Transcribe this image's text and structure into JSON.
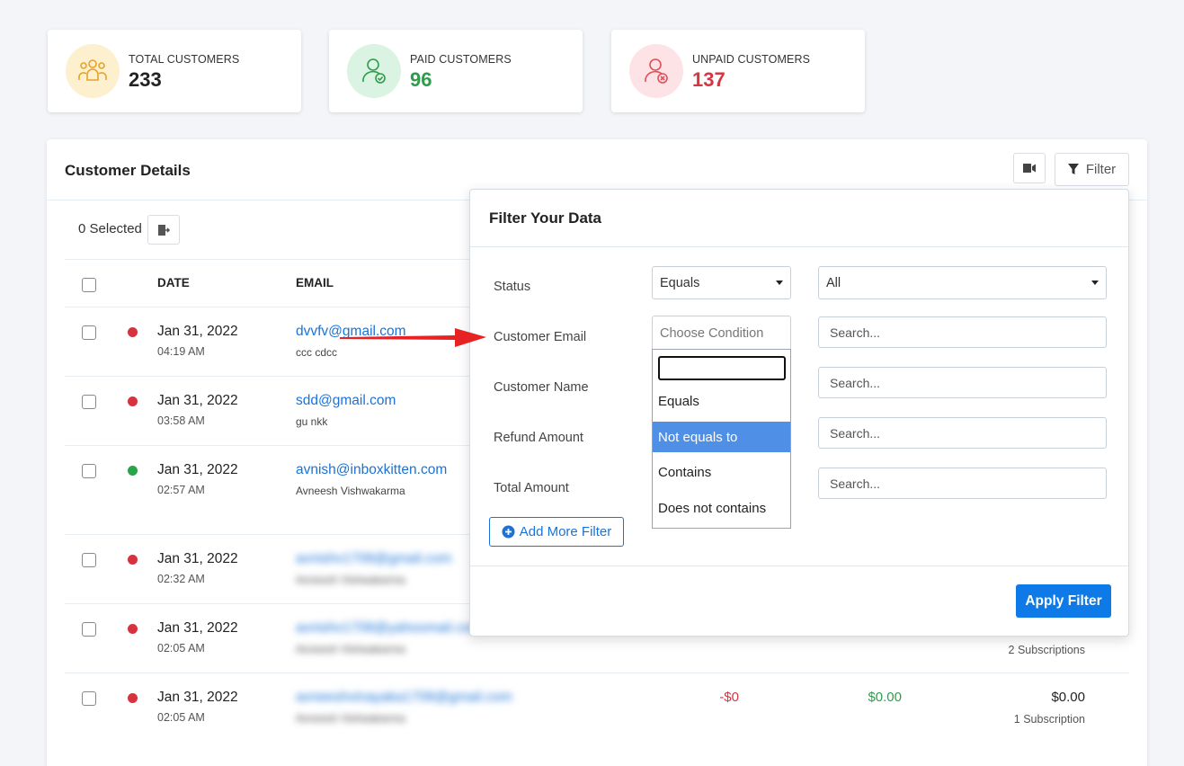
{
  "stats": [
    {
      "label": "TOTAL CUSTOMERS",
      "value": "233",
      "icon": "users-group-icon",
      "bg": "#fdf0cf",
      "value_color": "#222222"
    },
    {
      "label": "PAID CUSTOMERS",
      "value": "96",
      "icon": "user-check-icon",
      "bg": "#daf3e2",
      "value_color": "#2e9d4a"
    },
    {
      "label": "UNPAID CUSTOMERS",
      "value": "137",
      "icon": "user-x-icon",
      "bg": "#fde3e5",
      "value_color": "#d53641"
    }
  ],
  "panel": {
    "title": "Customer Details",
    "filter_label": "Filter",
    "selected_text": "0 Selected",
    "columns": {
      "date": "DATE",
      "email": "EMAIL"
    }
  },
  "rows": [
    {
      "date": "Jan 31, 2022",
      "time": "04:19 AM",
      "email": "dvvfv@gmail.com",
      "name": "ccc cdcc",
      "status_color": "#d9323f"
    },
    {
      "date": "Jan 31, 2022",
      "time": "03:58 AM",
      "email": "sdd@gmail.com",
      "name": "gu nkk",
      "status_color": "#d9323f"
    },
    {
      "date": "Jan 31, 2022",
      "time": "02:57 AM",
      "email": "avnish@inboxkitten.com",
      "name": "Avneesh Vishwakarma",
      "status_color": "#2aa44a"
    },
    {
      "date": "Jan 31, 2022",
      "time": "02:32 AM",
      "email": "avnishv1708@gmail.com",
      "name": "Avneesh Vishwakarma",
      "status_color": "#d9323f"
    },
    {
      "date": "Jan 31, 2022",
      "time": "02:05 AM",
      "email": "avnishv1708@yahoomail.com",
      "name": "Avneesh Vishwakarma",
      "status_color": "#d9323f"
    },
    {
      "date": "Jan 31, 2022",
      "time": "02:05 AM",
      "email": "avneeshvinayaka1708@gmail.com",
      "name": "Avneesh Vishwakarma",
      "status_color": "#d9323f"
    }
  ],
  "row5_extra": {
    "subscriptions": "2 Subscriptions"
  },
  "row6_extra": {
    "refund": "-$0",
    "paid": "$0.00",
    "total": "$0.00",
    "subscriptions": "1 Subscription"
  },
  "filter_popover": {
    "title": "Filter Your Data",
    "fields": [
      {
        "label": "Status",
        "condition": "Equals",
        "value": "All"
      },
      {
        "label": "Customer Email",
        "condition_placeholder": "Choose Condition",
        "search_placeholder": "Search..."
      },
      {
        "label": "Customer Name",
        "search_placeholder": "Search..."
      },
      {
        "label": "Refund Amount",
        "search_placeholder": "Search..."
      },
      {
        "label": "Total Amount",
        "search_placeholder": "Search..."
      }
    ],
    "dropdown_options": [
      "Equals",
      "Not equals to",
      "Contains",
      "Does not contains"
    ],
    "active_option": "Not equals to",
    "add_more_label": "Add More Filter",
    "apply_label": "Apply Filter"
  },
  "colors": {
    "accent": "#0d7ae8",
    "link": "#1a73d9",
    "negative": "#d53641",
    "positive": "#2e9d4a"
  }
}
